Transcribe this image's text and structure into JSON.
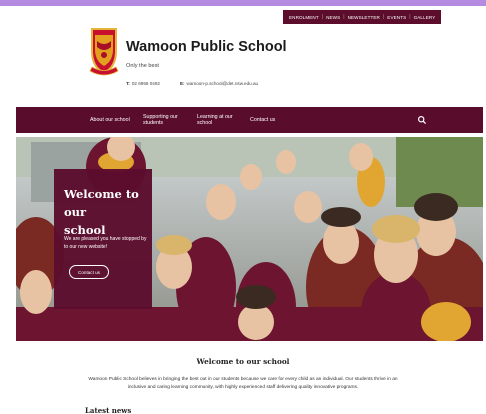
{
  "utility_nav": [
    "ENROLMENT",
    "NEWS",
    "NEWSLETTER",
    "EVENTS",
    "GALLERY"
  ],
  "school": {
    "name": "Wamoon Public School",
    "tagline": "Only the best",
    "phone_label": "T:",
    "phone": "02 6958 0492",
    "email_label": "E:",
    "email": "wamoon-p.school@det.nsw.edu.au"
  },
  "nav": {
    "about": "About our school",
    "support_1": "Supporting our",
    "support_2": "students",
    "learning_1": "Learning at our",
    "learning_2": "school",
    "contact": "Contact us"
  },
  "hero": {
    "title_1": "Welcome to our",
    "title_2": "school",
    "text": "We are pleased you have stopped by to our new website!",
    "button": "Contact us"
  },
  "intro": {
    "title": "Welcome to our school",
    "text": "Wamoon Public School believes in bringing the best out in our students because we care for every child as an individual. Our students thrive in an inclusive and caring learning community, with highly experienced staff delivering quality innovative programs."
  },
  "latest_news": "Latest news",
  "colors": {
    "brand": "#5a0c2c",
    "top_band": "#b48be0",
    "uniform_gold": "#e0a631"
  },
  "icons": {
    "search": "search-icon",
    "logo": "school-crest-logo"
  }
}
